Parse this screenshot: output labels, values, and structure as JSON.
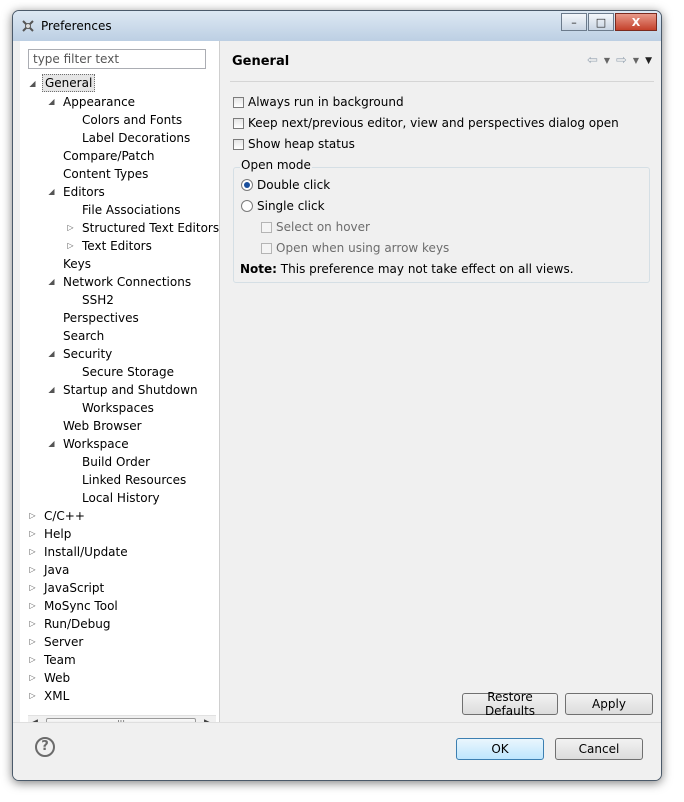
{
  "window": {
    "title": "Preferences",
    "controls": {
      "minimize": "–",
      "maximize": "□",
      "close": "X"
    }
  },
  "filter": {
    "placeholder": "type filter text"
  },
  "tree": [
    {
      "label": "General",
      "depth": 1,
      "twisty": "expanded",
      "selected": true
    },
    {
      "label": "Appearance",
      "depth": 2,
      "twisty": "expanded"
    },
    {
      "label": "Colors and Fonts",
      "depth": 3,
      "twisty": "none"
    },
    {
      "label": "Label Decorations",
      "depth": 3,
      "twisty": "none"
    },
    {
      "label": "Compare/Patch",
      "depth": 2,
      "twisty": "none"
    },
    {
      "label": "Content Types",
      "depth": 2,
      "twisty": "none"
    },
    {
      "label": "Editors",
      "depth": 2,
      "twisty": "expanded"
    },
    {
      "label": "File Associations",
      "depth": 3,
      "twisty": "none"
    },
    {
      "label": "Structured Text Editors",
      "depth": 3,
      "twisty": "collapsed"
    },
    {
      "label": "Text Editors",
      "depth": 3,
      "twisty": "collapsed"
    },
    {
      "label": "Keys",
      "depth": 2,
      "twisty": "none"
    },
    {
      "label": "Network Connections",
      "depth": 2,
      "twisty": "expanded"
    },
    {
      "label": "SSH2",
      "depth": 3,
      "twisty": "none"
    },
    {
      "label": "Perspectives",
      "depth": 2,
      "twisty": "none"
    },
    {
      "label": "Search",
      "depth": 2,
      "twisty": "none"
    },
    {
      "label": "Security",
      "depth": 2,
      "twisty": "expanded"
    },
    {
      "label": "Secure Storage",
      "depth": 3,
      "twisty": "none"
    },
    {
      "label": "Startup and Shutdown",
      "depth": 2,
      "twisty": "expanded"
    },
    {
      "label": "Workspaces",
      "depth": 3,
      "twisty": "none"
    },
    {
      "label": "Web Browser",
      "depth": 2,
      "twisty": "none"
    },
    {
      "label": "Workspace",
      "depth": 2,
      "twisty": "expanded"
    },
    {
      "label": "Build Order",
      "depth": 3,
      "twisty": "none"
    },
    {
      "label": "Linked Resources",
      "depth": 3,
      "twisty": "none"
    },
    {
      "label": "Local History",
      "depth": 3,
      "twisty": "none"
    },
    {
      "label": "C/C++",
      "depth": 1,
      "twisty": "collapsed"
    },
    {
      "label": "Help",
      "depth": 1,
      "twisty": "collapsed"
    },
    {
      "label": "Install/Update",
      "depth": 1,
      "twisty": "collapsed"
    },
    {
      "label": "Java",
      "depth": 1,
      "twisty": "collapsed"
    },
    {
      "label": "JavaScript",
      "depth": 1,
      "twisty": "collapsed"
    },
    {
      "label": "MoSync Tool",
      "depth": 1,
      "twisty": "collapsed"
    },
    {
      "label": "Run/Debug",
      "depth": 1,
      "twisty": "collapsed"
    },
    {
      "label": "Server",
      "depth": 1,
      "twisty": "collapsed"
    },
    {
      "label": "Team",
      "depth": 1,
      "twisty": "collapsed"
    },
    {
      "label": "Web",
      "depth": 1,
      "twisty": "collapsed"
    },
    {
      "label": "XML",
      "depth": 1,
      "twisty": "collapsed"
    }
  ],
  "page": {
    "title": "General",
    "options": [
      {
        "label": "Always run in background",
        "checked": false
      },
      {
        "label": "Keep next/previous editor, view and perspectives dialog open",
        "checked": false
      },
      {
        "label": "Show heap status",
        "checked": false
      }
    ],
    "open_mode": {
      "label": "Open mode",
      "double_click": "Double click",
      "single_click": "Single click",
      "select_on_hover": "Select on hover",
      "open_arrow_keys": "Open when using arrow keys",
      "selected": "Double click"
    },
    "note": {
      "prefix": "Note:",
      "text": "This preference may not take effect on all views."
    }
  },
  "buttons": {
    "restore_defaults": "Restore Defaults",
    "apply": "Apply",
    "ok": "OK",
    "cancel": "Cancel"
  },
  "icons": {
    "window": "preferences-gear-icon",
    "help": "help-icon",
    "back": "back-arrow-icon",
    "forward": "forward-arrow-icon"
  }
}
